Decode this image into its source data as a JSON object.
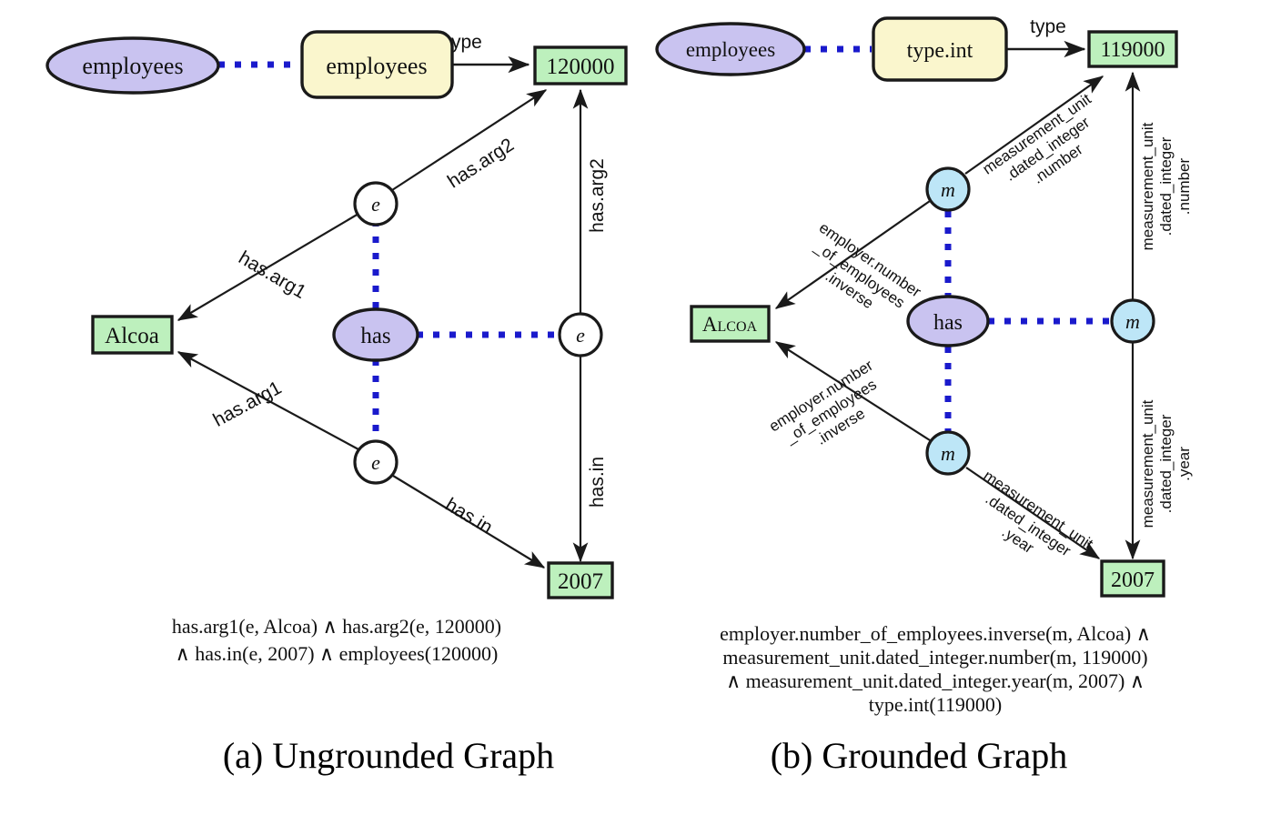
{
  "figure": {
    "background": "#ffffff",
    "colors": {
      "purple_fill": "#c9c3f0",
      "yellow_fill": "#faf6cd",
      "green_fill": "#bdf0bd",
      "blue_fill": "#bde6f7",
      "dotted_link": "#1a1acc",
      "stroke": "#1a1a1a"
    }
  },
  "panels": [
    {
      "id": "ungrounded",
      "caption": "(a) Ungrounded Graph",
      "nodes": {
        "utterance_ellipse": "employees",
        "predicate_box": "employees",
        "value_box": "120000",
        "entity_box": "Alcoa",
        "year_box": "2007",
        "event_node_top": "e",
        "event_node_mid": "e",
        "event_node_bottom": "e",
        "relation_ellipse": "has"
      },
      "edges": [
        {
          "id": "type-edge",
          "label": "type",
          "from": "predicate_box",
          "to": "value_box"
        },
        {
          "id": "top-has-arg2",
          "label": "has.arg2",
          "from": "event_node_top",
          "to": "value_box"
        },
        {
          "id": "top-has-arg1",
          "label": "has.arg1",
          "from": "event_node_top",
          "to": "entity_box"
        },
        {
          "id": "vertical-has-arg2",
          "label": "has.arg2",
          "from": "event_node_mid",
          "to": "value_box"
        },
        {
          "id": "vertical-has-in",
          "label": "has.in",
          "from": "event_node_mid",
          "to": "year_box"
        },
        {
          "id": "bottom-has-arg1",
          "label": "has.arg1",
          "from": "event_node_bottom",
          "to": "entity_box"
        },
        {
          "id": "bottom-has-in",
          "label": "has.in",
          "from": "event_node_bottom",
          "to": "year_box"
        }
      ],
      "formula_lines": [
        "has.arg1(e, Alcoa) ∧ has.arg2(e, 120000)",
        "∧ has.in(e, 2007) ∧  employees(120000)"
      ]
    },
    {
      "id": "grounded",
      "caption": "(b) Grounded Graph",
      "nodes": {
        "utterance_ellipse": "employees",
        "predicate_box": "type.int",
        "value_box": "119000",
        "entity_box": "Alcoa",
        "year_box": "2007",
        "event_node_top": "m",
        "event_node_mid": "m",
        "event_node_bottom": "m",
        "relation_ellipse": "has"
      },
      "edges": [
        {
          "id": "type-edge",
          "label": "type",
          "from": "predicate_box",
          "to": "value_box"
        },
        {
          "id": "top-number",
          "lines": [
            "measurement_unit",
            ".dated_integer",
            ".number"
          ],
          "from": "event_node_top",
          "to": "value_box"
        },
        {
          "id": "top-employer",
          "lines": [
            "employer.number",
            "_of_employees",
            ".inverse"
          ],
          "from": "event_node_top",
          "to": "entity_box"
        },
        {
          "id": "vertical-number",
          "lines": [
            "measurement_unit",
            ".dated_integer",
            ".number"
          ],
          "from": "event_node_mid",
          "to": "value_box"
        },
        {
          "id": "vertical-year",
          "lines": [
            "measurement_unit",
            ".dated_integer",
            ".year"
          ],
          "from": "event_node_mid",
          "to": "year_box"
        },
        {
          "id": "bottom-employer",
          "lines": [
            "employer.number",
            "_of_employees",
            ".inverse"
          ],
          "from": "event_node_bottom",
          "to": "entity_box"
        },
        {
          "id": "bottom-year",
          "lines": [
            "measurement_unit",
            ".dated_integer",
            ".year"
          ],
          "from": "event_node_bottom",
          "to": "year_box"
        }
      ],
      "formula_lines": [
        "employer.number_of_employees.inverse(m, Alcoa) ∧",
        "measurement_unit.dated_integer.number(m, 119000)",
        "∧ measurement_unit.dated_integer.year(m, 2007) ∧",
        "type.int(119000)"
      ]
    }
  ]
}
